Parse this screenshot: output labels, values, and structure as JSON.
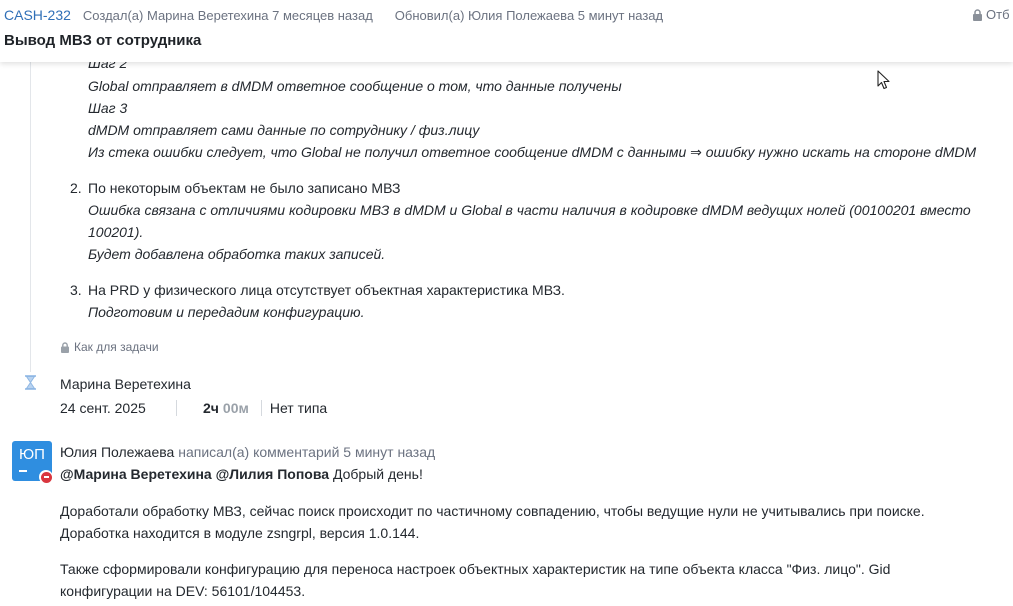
{
  "header": {
    "task_key": "CASH-232",
    "created": "Создал(а) Марина Веретехина 7 месяцев назад",
    "updated": "Обновил(а) Юлия Полежаева 5 минут назад",
    "visibility_label": "Отб",
    "title": "Вывод МВЗ от сотрудника"
  },
  "description": {
    "step2_label": "Шаг 2",
    "step2_text": "Global отправляет в dMDM ответное сообщение о том, что данные получены",
    "step3_label": "Шаг 3",
    "step3_text": "dMDM отправляет сами данные по сотруднику / физ.лицу",
    "stack_note": "Из стека ошибки следует, что Global не получил ответное сообщение dMDM с данными ⇒ ошибку нужно искать на стороне dMDM",
    "items": [
      {
        "number": "2.",
        "title": "По некоторым объектам не было записано МВЗ",
        "detail_1": "Ошибка связана с отличиями кодировки МВЗ в dMDM и Global в части наличия в кодировке dMDM ведущих нолей (00100201 вместо",
        "detail_2": "100201).",
        "detail_3": "Будет добавлена обработка таких записей."
      },
      {
        "number": "3.",
        "title": "На PRD у физического лица отсутствует объектная характеристика МВЗ.",
        "detail_1": "Подготовим и передадим конфигурацию."
      }
    ],
    "visibility": "Как для задачи"
  },
  "worklog": {
    "author": "Марина Веретехина",
    "date": "24 сент. 2025",
    "hours": "2ч",
    "minutes": "00м",
    "type": "Нет типа"
  },
  "comment": {
    "avatar_initials": "ЮП",
    "author": "Юлия Полежаева",
    "action": "написал(а) комментарий 5 минут назад",
    "mention_1": "@Марина Веретехина",
    "mention_2": "@Лилия Попова",
    "greeting": "Добрый день!",
    "para1_line1": "Доработали обработку МВЗ, сейчас поиск происходит по частичному совпадению, чтобы ведущие нули не учитывались при поиске.",
    "para1_line2": "Доработка находится в модуле zsngrpl, версия 1.0.144.",
    "para2_line1": "Также сформировали конфигурацию для переноса настроек объектных характеристик на типе объекта класса \"Физ. лицо\". Gid",
    "para2_line2": "конфигурации на DEV: 56101/104453."
  },
  "colors": {
    "link": "#2f6fb7",
    "avatar": "#2f8ee0",
    "muted": "#6b7280"
  }
}
